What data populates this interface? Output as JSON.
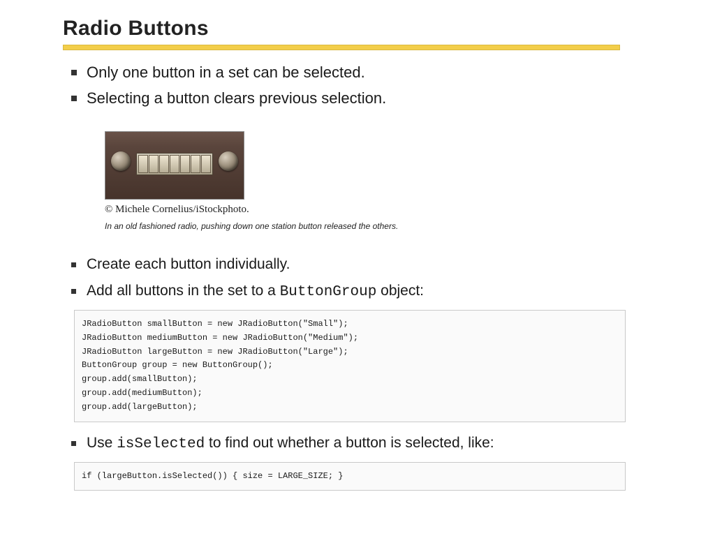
{
  "slide": {
    "title": "Radio Buttons",
    "bullets_top": [
      "Only one button in a set can be selected.",
      "Selecting a button clears previous selection."
    ],
    "figure": {
      "credit": "© Michele Cornelius/iStockphoto.",
      "caption": "In an old fashioned radio, pushing down one station button released the others."
    },
    "bullets_mid": {
      "b1": "Create each button individually.",
      "b2_pre": "Add all buttons in the set to a ",
      "b2_code": "ButtonGroup",
      "b2_post": " object:",
      "b3_pre": "Use ",
      "b3_code": "isSelected",
      "b3_post": " to find out whether a button is selected, like:"
    },
    "code1": "JRadioButton smallButton = new JRadioButton(\"Small\");\nJRadioButton mediumButton = new JRadioButton(\"Medium\");\nJRadioButton largeButton = new JRadioButton(\"Large\");\nButtonGroup group = new ButtonGroup();\ngroup.add(smallButton);\ngroup.add(mediumButton);\ngroup.add(largeButton);",
    "code2": "if (largeButton.isSelected()) { size = LARGE_SIZE; }"
  }
}
